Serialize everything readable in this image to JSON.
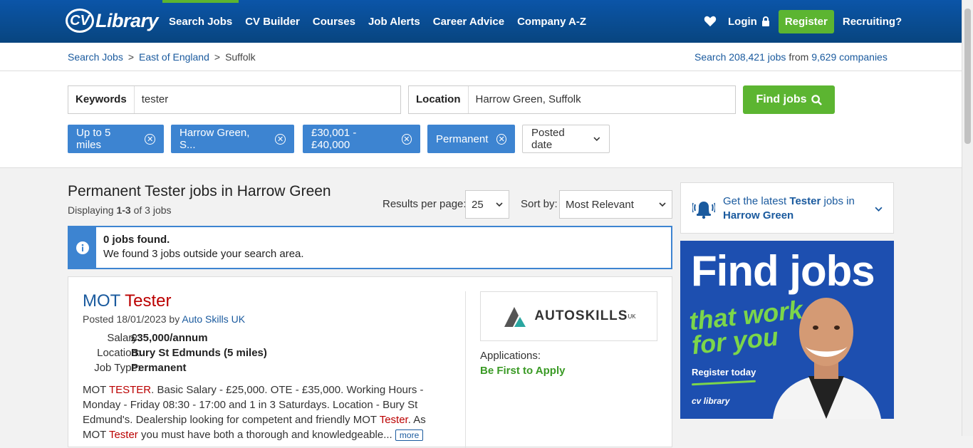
{
  "header": {
    "logo_cv": "CV",
    "logo_lib": "Library",
    "nav": [
      "Search Jobs",
      "CV Builder",
      "Courses",
      "Job Alerts",
      "Career Advice",
      "Company A-Z"
    ],
    "login": "Login",
    "register": "Register",
    "recruiting": "Recruiting?"
  },
  "breadcrumb": {
    "items": [
      "Search Jobs",
      "East of England",
      "Suffolk"
    ],
    "stats_pre": "Search",
    "jobs_count": "208,421 jobs",
    "stats_mid": "from",
    "companies_count": "9,629 companies"
  },
  "search": {
    "keywords_label": "Keywords",
    "keywords_value": "tester",
    "location_label": "Location",
    "location_value": "Harrow Green, Suffolk",
    "find_button": "Find jobs",
    "filters": [
      "Up to 5 miles",
      "Harrow Green, S...",
      "£30,001 - £40,000",
      "Permanent"
    ],
    "posted_date": "Posted date"
  },
  "results": {
    "title": "Permanent Tester jobs in Harrow Green",
    "display_pre": "Displaying",
    "display_range": "1-3",
    "display_post": "of 3 jobs",
    "per_page_label": "Results per page:",
    "per_page_value": "25",
    "sort_label": "Sort by:",
    "sort_value": "Most Relevant",
    "info_line1": "0 jobs found.",
    "info_line2": "We found 3 jobs outside your search area."
  },
  "job": {
    "title_a": "MOT",
    "title_b": "Tester",
    "posted": "Posted 18/01/2023 by",
    "company": "Auto Skills UK",
    "salary_label": "Salary:",
    "salary": "£35,000/annum",
    "location_label": "Location:",
    "location": "Bury St Edmunds (5 miles)",
    "type_label": "Job Type:",
    "type": "Permanent",
    "desc_1": "MOT ",
    "desc_hl1": "TESTER",
    "desc_2": ". Basic Salary - £25,000. OTE - £35,000. Working Hours - Monday - Friday 08:30 - 17:00 and 1 in 3 Saturdays. Location - Bury St Edmund's. Dealership looking for competent and friendly MOT ",
    "desc_hl2": "Tester",
    "desc_3": ". As MOT ",
    "desc_hl3": "Tester",
    "desc_4": " you must have both a thorough and knowledgeable...",
    "more": "more",
    "company_logo_text": "AUTOSKILLS",
    "company_logo_sup": "UK",
    "applications_label": "Applications:",
    "applications_value": "Be First to Apply"
  },
  "alert": {
    "pre": "Get the latest",
    "kw": "Tester",
    "mid": "jobs in",
    "loc": "Harrow Green"
  },
  "ad": {
    "headline": "Find jobs",
    "sub_1": "that work",
    "sub_2": "for you",
    "cta": "Register today",
    "brand": "cv library"
  }
}
